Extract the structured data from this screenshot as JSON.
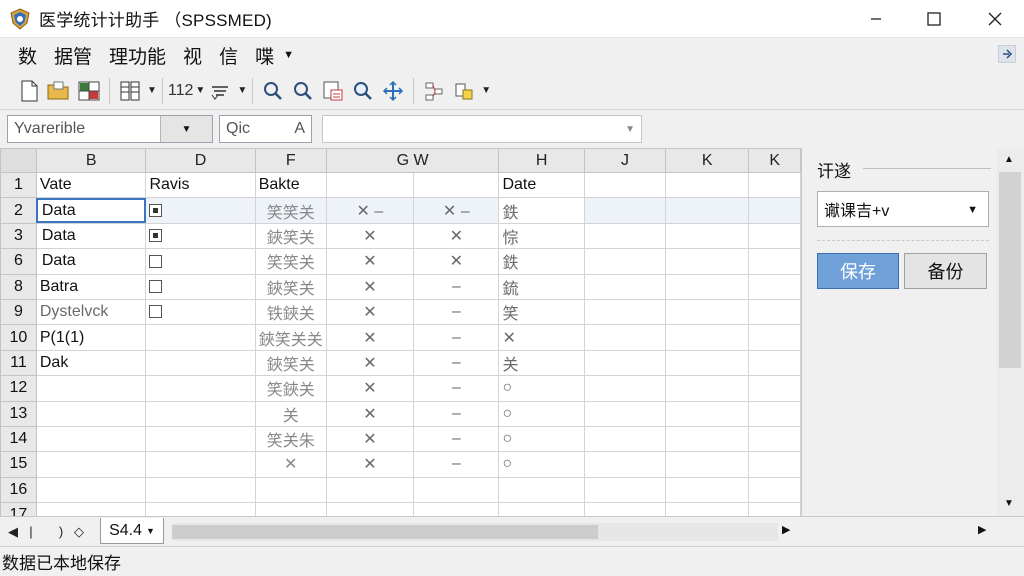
{
  "window": {
    "title": "医学统计计助手 （SPSSMED)"
  },
  "menu": {
    "items": [
      "数",
      "据管",
      "理功能",
      "视",
      "信",
      "喋"
    ]
  },
  "toolbar": {
    "numfmt_label": "112"
  },
  "formula": {
    "variable_value": "Yvarerible",
    "cell_ref": "Qic",
    "cell_ref_icon": "A"
  },
  "grid": {
    "columns": [
      "B",
      "D",
      "F",
      "G W",
      "H",
      "H",
      "J",
      "K",
      "K"
    ],
    "rows": [
      {
        "num": "1",
        "cells": [
          "Vate",
          "Ravis",
          "Bakte",
          "",
          "",
          "Date"
        ]
      },
      {
        "num": "2",
        "cells": [
          "Data",
          "",
          "笑笑关",
          "✕ –",
          "✕ –",
          "鉄"
        ]
      },
      {
        "num": "3",
        "cells": [
          "Data",
          "",
          "鋏笑关",
          "✕",
          "✕",
          "悰"
        ]
      },
      {
        "num": "6",
        "cells": [
          "Data",
          "",
          "笑笑关",
          "✕",
          "✕",
          "鉄"
        ]
      },
      {
        "num": "8",
        "cells": [
          "Batra",
          "",
          "鋏笑关",
          "✕",
          "–",
          "鋶"
        ]
      },
      {
        "num": "9",
        "cells": [
          "Dystelvck",
          "",
          "铁鋏关",
          "✕",
          "–",
          "笑"
        ]
      },
      {
        "num": "10",
        "cells": [
          "P(1(1)",
          "",
          "鋏笑关关",
          "✕",
          "–",
          "✕"
        ]
      },
      {
        "num": "11",
        "cells": [
          "Dak",
          "",
          "鋏笑关",
          "✕",
          "–",
          "关"
        ]
      },
      {
        "num": "12",
        "cells": [
          "",
          "",
          "笑鋏关",
          "✕",
          "–",
          "○"
        ]
      },
      {
        "num": "13",
        "cells": [
          "",
          "",
          "关",
          "✕",
          "–",
          "○"
        ]
      },
      {
        "num": "14",
        "cells": [
          "",
          "",
          "笑关朱",
          "✕",
          "–",
          "○"
        ]
      },
      {
        "num": "15",
        "cells": [
          "",
          "",
          "✕",
          "✕",
          "–",
          "○"
        ]
      },
      {
        "num": "16",
        "cells": [
          "",
          "",
          "",
          "",
          "",
          ""
        ]
      },
      {
        "num": "17",
        "cells": [
          "",
          "",
          "",
          "",
          "",
          ""
        ]
      }
    ]
  },
  "sheet_tabs": {
    "active": "S4.4"
  },
  "side_panel": {
    "filter_label": "讦遂",
    "filter_value": "谳课吉+v",
    "save_label": "保存",
    "backup_label": "备份"
  },
  "status": {
    "text": "数据已本地保存"
  },
  "colors": {
    "accent": "#6fa0d8",
    "selection": "#3a75c4"
  }
}
